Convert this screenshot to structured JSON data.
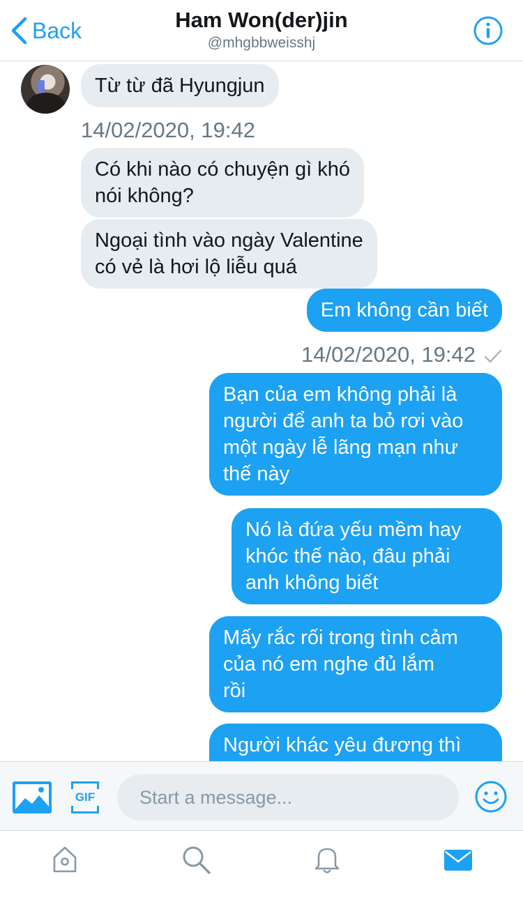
{
  "header": {
    "back_label": "Back",
    "title": "Ham Won(der)jin",
    "handle": "@mhgbbweisshj"
  },
  "messages": [
    {
      "dir": "in",
      "lines": [
        "Từ từ đã Hyungjun"
      ]
    },
    {
      "dir": "in",
      "timestamp": "14/02/2020, 19:42"
    },
    {
      "dir": "in",
      "lines": [
        "Có khi nào có chuyện gì khó",
        "nói không?"
      ]
    },
    {
      "dir": "in",
      "lines": [
        "Ngoại tình vào ngày Valentine",
        "có vẻ là hơi lộ liễu quá"
      ]
    },
    {
      "dir": "out",
      "lines": [
        "Em không cần biết"
      ]
    },
    {
      "dir": "out",
      "timestamp": "14/02/2020, 19:42"
    },
    {
      "dir": "out",
      "lines": [
        "Bạn của em không phải là",
        "người để anh ta bỏ rơi vào",
        "một ngày lễ lãng mạn như",
        "thế này"
      ]
    },
    {
      "dir": "out",
      "lines": [
        "Nó là đứa yếu mềm hay",
        "khóc thế nào, đâu phải",
        "anh không biết"
      ]
    },
    {
      "dir": "out",
      "lines": [
        "Mấy rắc rối trong tình cảm",
        "của nó em nghe đủ lắm",
        "rồi"
      ]
    },
    {
      "dir": "out",
      "lines": [
        "Người khác yêu đương thì"
      ]
    }
  ],
  "composer": {
    "placeholder": "Start a message...",
    "gif_label": "GIF",
    "value": ""
  },
  "tabs": [
    {
      "icon": "home-icon",
      "active": false
    },
    {
      "icon": "search-icon",
      "active": false
    },
    {
      "icon": "bell-icon",
      "active": false
    },
    {
      "icon": "mail-icon",
      "active": true
    }
  ],
  "colors": {
    "accent": "#1da1f2",
    "incoming_bubble": "#e6ecf0",
    "secondary_text": "#657786",
    "primary_text": "#14171a",
    "inactive_icon": "#8899a6"
  }
}
